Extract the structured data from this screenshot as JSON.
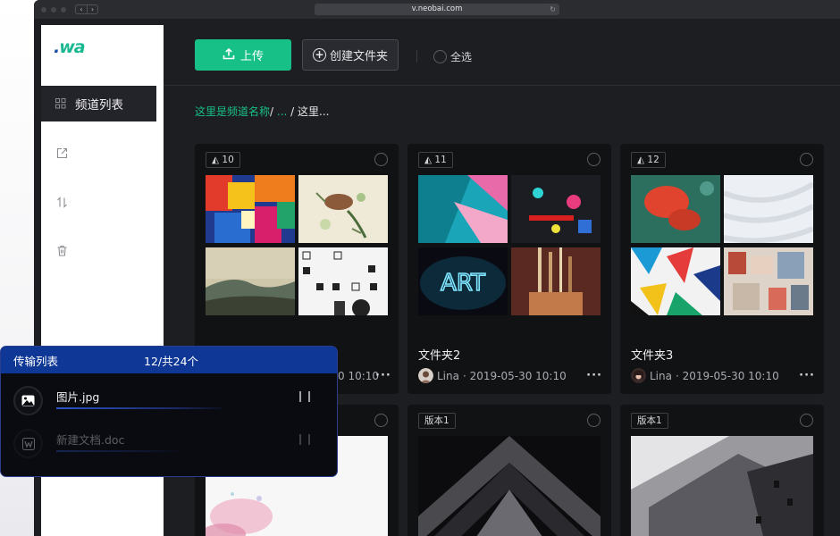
{
  "browser": {
    "url": "v.neobai.com",
    "back": "‹",
    "forward": "›"
  },
  "brand": {
    "logo_dot": ".",
    "logo_text": "wa"
  },
  "sidebar": {
    "active_label": "频道列表"
  },
  "toolbar": {
    "upload_label": "上传",
    "new_folder_label": "创建文件夹",
    "select_all_label": "全选"
  },
  "breadcrumb": {
    "channel": "这里是频道名称",
    "sep1": "/ ",
    "ellipsis": "...",
    "sep2": " / ",
    "current": "这里..."
  },
  "cards": [
    {
      "count": "10",
      "title": "",
      "author": "",
      "date": "",
      "more": "···"
    },
    {
      "count": "11",
      "title": "文件夹2",
      "author": "Lina",
      "date": "· 2019-05-30 10:10",
      "more": "···",
      "neon_text": "ART"
    },
    {
      "count": "12",
      "title": "文件夹3",
      "author": "Lina",
      "date": "· 2019-05-30 10:10",
      "more": "···"
    },
    {
      "version": "版本1"
    },
    {
      "version": "版本1"
    }
  ],
  "card1_partial_meta": "0 10:10",
  "card1_more": "···",
  "transfer": {
    "title": "传输列表",
    "count": "12/共24个",
    "items": [
      {
        "name": "图片.jpg",
        "progress": 0.45,
        "pause": "❙❙"
      },
      {
        "name": "新建文档.doc",
        "progress": 0.3,
        "pause": "❙❙"
      }
    ]
  }
}
